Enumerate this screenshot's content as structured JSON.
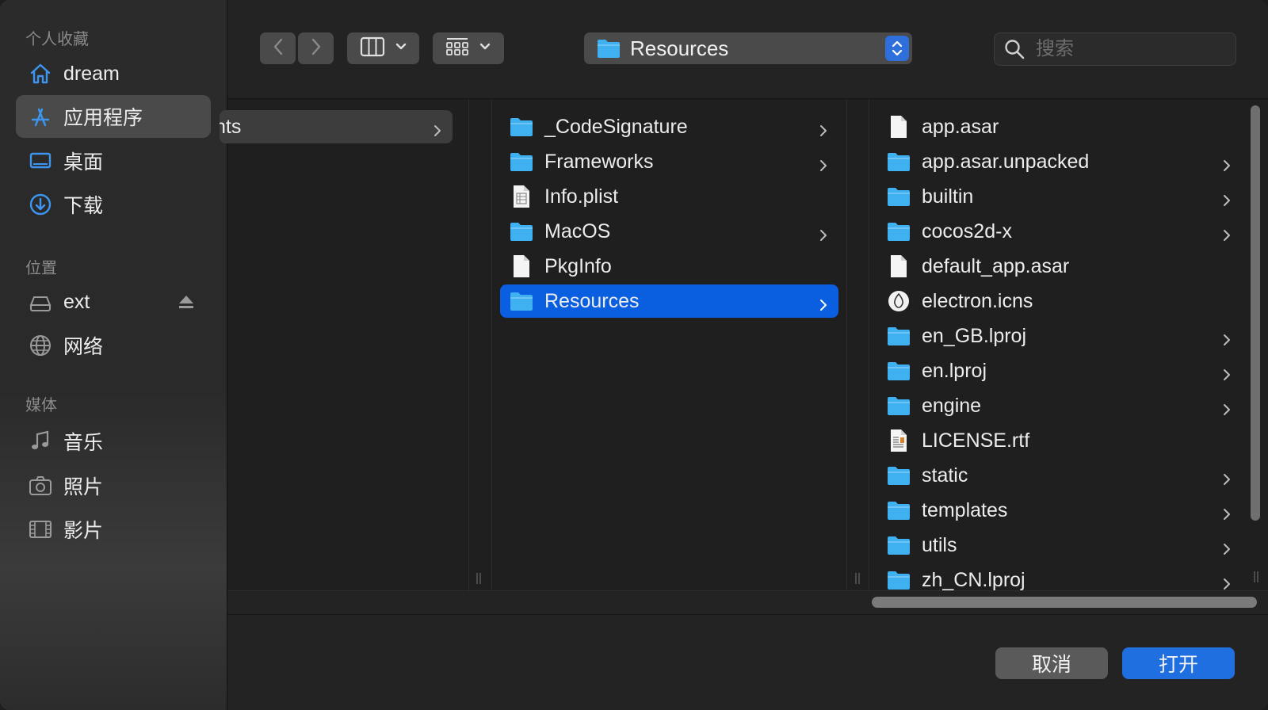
{
  "sidebar": {
    "sections": {
      "favorites": "个人收藏",
      "locations": "位置",
      "media": "媒体"
    },
    "favorites": [
      {
        "label": "dream",
        "icon": "home-icon"
      },
      {
        "label": "应用程序",
        "icon": "applications-icon",
        "selected": true
      },
      {
        "label": "桌面",
        "icon": "desktop-icon"
      },
      {
        "label": "下载",
        "icon": "download-icon"
      }
    ],
    "locations": [
      {
        "label": "ext",
        "icon": "drive-icon",
        "ejectable": true
      },
      {
        "label": "网络",
        "icon": "globe-icon"
      }
    ],
    "media": [
      {
        "label": "音乐",
        "icon": "music-icon"
      },
      {
        "label": "照片",
        "icon": "camera-icon"
      },
      {
        "label": "影片",
        "icon": "film-icon"
      }
    ]
  },
  "toolbar": {
    "path": "Resources",
    "search_placeholder": "搜索"
  },
  "columns": {
    "col1": [
      {
        "label": "nts",
        "type": "folder",
        "has_children": true,
        "state": "prev-selected"
      }
    ],
    "col2": [
      {
        "label": "_CodeSignature",
        "type": "folder",
        "has_children": true
      },
      {
        "label": "Frameworks",
        "type": "folder",
        "has_children": true
      },
      {
        "label": "Info.plist",
        "type": "plist",
        "has_children": false
      },
      {
        "label": "MacOS",
        "type": "folder",
        "has_children": true
      },
      {
        "label": "PkgInfo",
        "type": "file",
        "has_children": false
      },
      {
        "label": "Resources",
        "type": "folder",
        "has_children": true,
        "state": "selected"
      }
    ],
    "col3": [
      {
        "label": "app.asar",
        "type": "file",
        "has_children": false
      },
      {
        "label": "app.asar.unpacked",
        "type": "folder",
        "has_children": true
      },
      {
        "label": "builtin",
        "type": "folder",
        "has_children": true
      },
      {
        "label": "cocos2d-x",
        "type": "folder",
        "has_children": true
      },
      {
        "label": "default_app.asar",
        "type": "file",
        "has_children": false
      },
      {
        "label": "electron.icns",
        "type": "icns",
        "has_children": false
      },
      {
        "label": "en_GB.lproj",
        "type": "folder",
        "has_children": true
      },
      {
        "label": "en.lproj",
        "type": "folder",
        "has_children": true
      },
      {
        "label": "engine",
        "type": "folder",
        "has_children": true
      },
      {
        "label": "LICENSE.rtf",
        "type": "rtf",
        "has_children": false
      },
      {
        "label": "static",
        "type": "folder",
        "has_children": true
      },
      {
        "label": "templates",
        "type": "folder",
        "has_children": true
      },
      {
        "label": "utils",
        "type": "folder",
        "has_children": true
      },
      {
        "label": "zh_CN.lproj",
        "type": "folder",
        "has_children": true
      }
    ]
  },
  "buttons": {
    "cancel": "取消",
    "open": "打开"
  },
  "colors": {
    "accent": "#0a5fe0",
    "folder": "#3fb0f0",
    "sidebar_icon": "#3d95ef"
  }
}
